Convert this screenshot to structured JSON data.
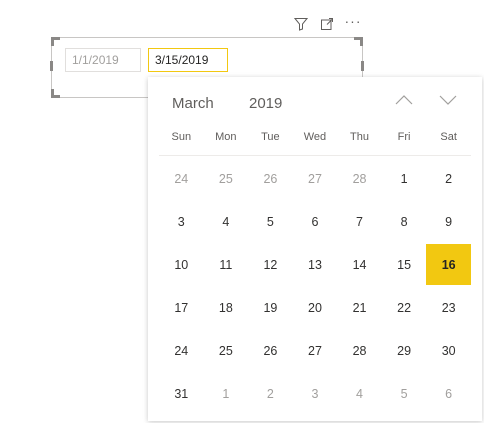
{
  "toolbar": {
    "filter_icon": "filter-icon",
    "focus_icon": "focus-mode-icon",
    "more_label": "···"
  },
  "slicer": {
    "start_date": "1/1/2019",
    "end_date": "3/15/2019"
  },
  "calendar": {
    "month": "March",
    "year": "2019",
    "weekdays": [
      "Sun",
      "Mon",
      "Tue",
      "Wed",
      "Thu",
      "Fri",
      "Sat"
    ],
    "weeks": [
      [
        "24",
        "25",
        "26",
        "27",
        "28",
        "1",
        "2"
      ],
      [
        "3",
        "4",
        "5",
        "6",
        "7",
        "8",
        "9"
      ],
      [
        "10",
        "11",
        "12",
        "13",
        "14",
        "15",
        "16"
      ],
      [
        "17",
        "18",
        "19",
        "20",
        "21",
        "22",
        "23"
      ],
      [
        "24",
        "25",
        "26",
        "27",
        "28",
        "29",
        "30"
      ],
      [
        "31",
        "1",
        "2",
        "3",
        "4",
        "5",
        "6"
      ]
    ],
    "selected_day": "16",
    "accent_color": "#F2C811"
  }
}
